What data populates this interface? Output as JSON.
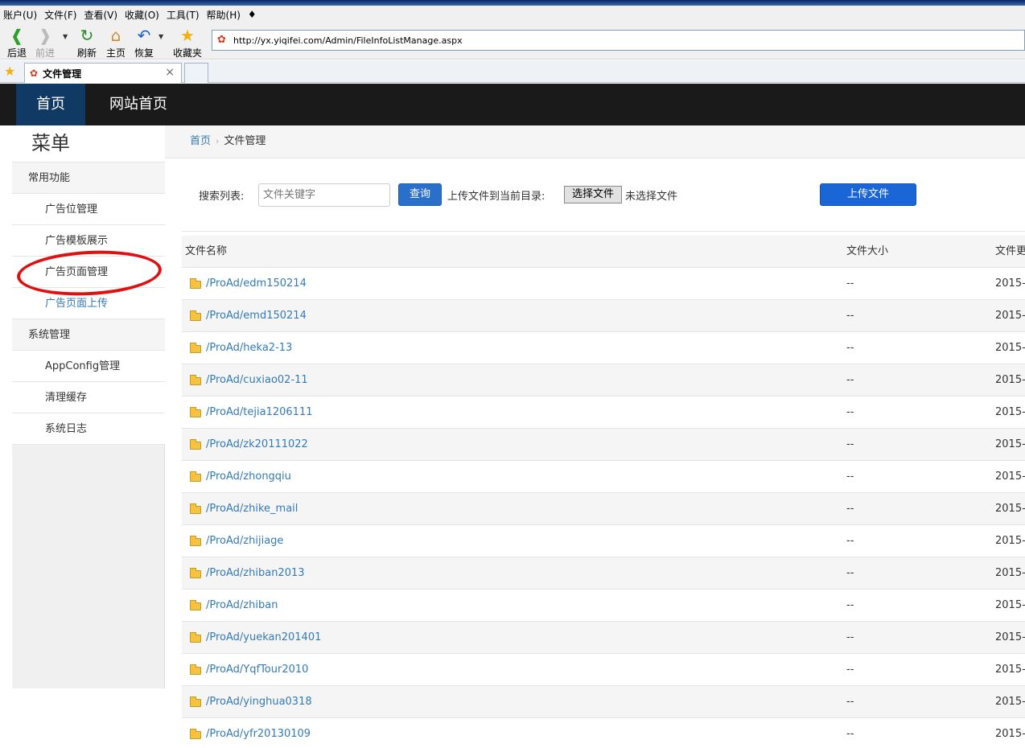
{
  "browser": {
    "menu": [
      "账户(U)",
      "文件(F)",
      "查看(V)",
      "收藏(O)",
      "工具(T)",
      "帮助(H)"
    ],
    "toolbar": {
      "back": "后退",
      "forward": "前进",
      "refresh": "刷新",
      "home": "主页",
      "restore": "恢复",
      "favorites": "收藏夹"
    },
    "address": "http://yx.yiqifei.com/Admin/FileInfoListManage.aspx",
    "tab_title": "文件管理",
    "tab_close": "×"
  },
  "header": {
    "nav_home": "首页",
    "nav_site": "网站首页"
  },
  "sidebar": {
    "title": "菜单",
    "group1": "常用功能",
    "items1": [
      "广告位管理",
      "广告模板展示",
      "广告页面管理",
      "广告页面上传"
    ],
    "group2": "系统管理",
    "items2": [
      "AppConfig管理",
      "清理缓存",
      "系统日志"
    ]
  },
  "breadcrumb": {
    "home": "首页",
    "current": "文件管理"
  },
  "search": {
    "label": "搜索列表:",
    "placeholder": "文件关键字",
    "query_button": "查询",
    "upload_label": "上传文件到当前目录:",
    "choose_button": "选择文件",
    "no_file": "未选择文件",
    "upload_button": "上传文件"
  },
  "table": {
    "headers": [
      "文件名称",
      "文件大小",
      "文件更"
    ],
    "rows": [
      {
        "name": "/ProAd/edm150214",
        "size": "--",
        "date": "2015-"
      },
      {
        "name": "/ProAd/emd150214",
        "size": "--",
        "date": "2015-"
      },
      {
        "name": "/ProAd/heka2-13",
        "size": "--",
        "date": "2015-"
      },
      {
        "name": "/ProAd/cuxiao02-11",
        "size": "--",
        "date": "2015-"
      },
      {
        "name": "/ProAd/tejia1206111",
        "size": "--",
        "date": "2015-"
      },
      {
        "name": "/ProAd/zk20111022",
        "size": "--",
        "date": "2015-"
      },
      {
        "name": "/ProAd/zhongqiu",
        "size": "--",
        "date": "2015-"
      },
      {
        "name": "/ProAd/zhike_mail",
        "size": "--",
        "date": "2015-"
      },
      {
        "name": "/ProAd/zhijiage",
        "size": "--",
        "date": "2015-"
      },
      {
        "name": "/ProAd/zhiban2013",
        "size": "--",
        "date": "2015-"
      },
      {
        "name": "/ProAd/zhiban",
        "size": "--",
        "date": "2015-"
      },
      {
        "name": "/ProAd/yuekan201401",
        "size": "--",
        "date": "2015-"
      },
      {
        "name": "/ProAd/YqfTour2010",
        "size": "--",
        "date": "2015-"
      },
      {
        "name": "/ProAd/yinghua0318",
        "size": "--",
        "date": "2015-"
      },
      {
        "name": "/ProAd/yfr20130109",
        "size": "--",
        "date": "2015-"
      }
    ]
  }
}
